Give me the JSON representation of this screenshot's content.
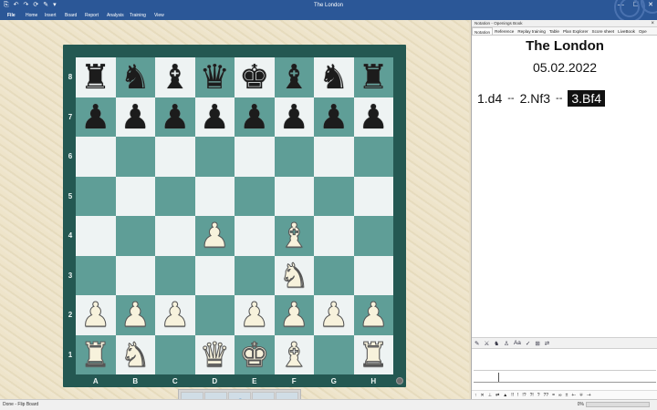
{
  "window": {
    "title": "The London",
    "quick_access": [
      "⎘",
      "↶",
      "↷",
      "⟳",
      "✎",
      "▾"
    ],
    "minimize": "—",
    "maximize": "☐",
    "close": "✕"
  },
  "ribbon": {
    "tabs": [
      "File",
      "Home",
      "Insert",
      "Board",
      "Report",
      "Analysis",
      "Training",
      "View"
    ]
  },
  "board": {
    "files": [
      "A",
      "B",
      "C",
      "D",
      "E",
      "F",
      "G",
      "H"
    ],
    "ranks": [
      "8",
      "7",
      "6",
      "5",
      "4",
      "3",
      "2",
      "1"
    ],
    "position": [
      [
        "br",
        "bn",
        "bb",
        "bq",
        "bk",
        "bb",
        "bn",
        "br"
      ],
      [
        "bp",
        "bp",
        "bp",
        "bp",
        "bp",
        "bp",
        "bp",
        "bp"
      ],
      [
        "",
        "",
        "",
        "",
        "",
        "",
        "",
        ""
      ],
      [
        "",
        "",
        "",
        "",
        "",
        "",
        "",
        ""
      ],
      [
        "",
        "",
        "",
        "wp",
        "",
        "wb",
        "",
        ""
      ],
      [
        "",
        "",
        "",
        "",
        "",
        "wn",
        "",
        ""
      ],
      [
        "wp",
        "wp",
        "wp",
        "",
        "wp",
        "wp",
        "wp",
        "wp"
      ],
      [
        "wr",
        "wn",
        "",
        "wq",
        "wk",
        "wb",
        "",
        "wr"
      ]
    ],
    "light_color": "#eef3f3",
    "dark_color": "#5f9e97",
    "frame_color": "#245852"
  },
  "nav": {
    "first": "⇤",
    "prev": "⇦",
    "undo": "↶",
    "next": "⇨",
    "last": "⇥"
  },
  "notation": {
    "pane_title": "Notation - Openings Book",
    "close": "×",
    "tabs": [
      "Notation",
      "Reference",
      "Replay training",
      "Table",
      "Plan Explorer",
      "Score sheet",
      "LiveBook",
      "Ope"
    ],
    "game_title": "The London",
    "date": "05.02.2022",
    "moves": [
      "1.d4",
      "2.Nf3",
      "3.Bf4"
    ],
    "separator": "--",
    "current_move": "3.Bf4",
    "toolbar_icons": [
      "✎",
      "⚔",
      "♞",
      "♙",
      "Aa",
      "✓",
      "⊞",
      "⇄"
    ],
    "annotations": [
      "↑",
      "✕",
      "⊥",
      "⇄",
      "▲",
      "!!",
      "!",
      "!?",
      "?!",
      "?",
      "??",
      "=",
      "∞",
      "±",
      "+-",
      "∓",
      "-+"
    ]
  },
  "status": {
    "left": "Done - Flip Board",
    "zoom": "0%"
  }
}
